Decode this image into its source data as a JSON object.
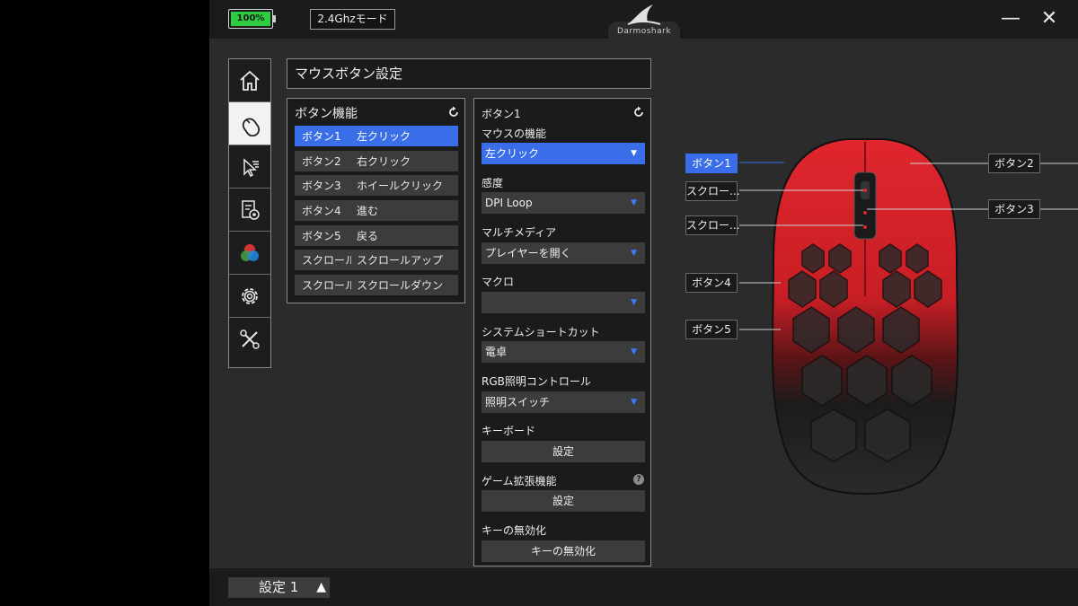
{
  "titlebar": {
    "battery": "100%",
    "mode": "2.4Ghzモード",
    "logo_text": "Darmoshark",
    "minimize": "—",
    "close": "✕"
  },
  "sidebar": {
    "items": [
      {
        "name": "home-icon",
        "active": false
      },
      {
        "name": "mouse-icon",
        "active": true
      },
      {
        "name": "pointer-speed-icon",
        "active": false
      },
      {
        "name": "macro-settings-icon",
        "active": false
      },
      {
        "name": "rgb-lighting-icon",
        "active": false
      },
      {
        "name": "gear-icon",
        "active": false
      },
      {
        "name": "tools-icon",
        "active": false
      }
    ]
  },
  "section_header": "マウスボタン設定",
  "button_panel": {
    "title": "ボタン機能",
    "rows": [
      {
        "name": "ボタン1",
        "func": "左クリック",
        "active": true
      },
      {
        "name": "ボタン2",
        "func": "右クリック",
        "active": false
      },
      {
        "name": "ボタン3",
        "func": "ホイールクリック",
        "active": false
      },
      {
        "name": "ボタン4",
        "func": "進む",
        "active": false
      },
      {
        "name": "ボタン5",
        "func": "戻る",
        "active": false
      },
      {
        "name": "スクロール...",
        "func": "スクロールアップ",
        "active": false
      },
      {
        "name": "スクロール...",
        "func": "スクロールダウン",
        "active": false
      }
    ]
  },
  "settings_panel": {
    "title": "ボタン1",
    "mouse_function": {
      "label": "マウスの機能",
      "value": "左クリック"
    },
    "sensitivity": {
      "label": "感度",
      "value": "DPI Loop"
    },
    "multimedia": {
      "label": "マルチメディア",
      "value": "プレイヤーを開く"
    },
    "macro": {
      "label": "マクロ",
      "value": ""
    },
    "shortcut": {
      "label": "システムショートカット",
      "value": "電卓"
    },
    "rgb": {
      "label": "RGB照明コントロール",
      "value": "照明スイッチ"
    },
    "keyboard": {
      "label": "キーボード",
      "button": "設定"
    },
    "game": {
      "label": "ゲーム拡張機能",
      "button": "設定",
      "help": "?"
    },
    "disable": {
      "label": "キーの無効化",
      "button": "キーの無効化"
    }
  },
  "mouse_callouts": {
    "b1": "ボタン1",
    "b2": "ボタン2",
    "s1": "スクロー...",
    "s2": "スクロー...",
    "b3": "ボタン3",
    "b4": "ボタン4",
    "b5": "ボタン5"
  },
  "footer": {
    "profile": "設定 1",
    "up": "▲"
  },
  "colors": {
    "accent": "#3a6ee8",
    "mouse_red": "#d8232a",
    "battery_green": "#2ecc40"
  }
}
